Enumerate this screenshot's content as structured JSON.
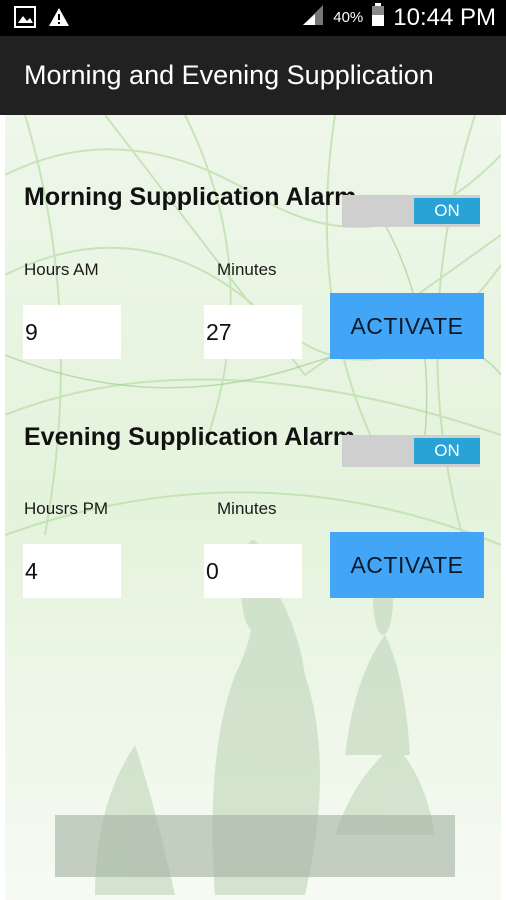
{
  "status_bar": {
    "time": "10:44 PM",
    "battery_percent": "40%",
    "icons": [
      "image-notification-icon",
      "warning-icon",
      "signal-icon",
      "battery-icon"
    ]
  },
  "app_bar": {
    "title": "Morning and Evening Supplication"
  },
  "morning": {
    "title": "Morning Supplication Alarm",
    "toggle_label": "ON",
    "hours_label": "Hours AM",
    "minutes_label": "Minutes",
    "hours_value": "9",
    "minutes_value": "27",
    "activate_label": "ACTIVATE"
  },
  "evening": {
    "title": "Evening Supplication Alarm",
    "toggle_label": "ON",
    "hours_label": "Housrs PM",
    "minutes_label": "Minutes",
    "hours_value": "4",
    "minutes_value": "0",
    "activate_label": "ACTIVATE"
  },
  "colors": {
    "app_bar": "#212121",
    "accent_button": "#42a5f5",
    "toggle_on": "#29a3d6"
  }
}
